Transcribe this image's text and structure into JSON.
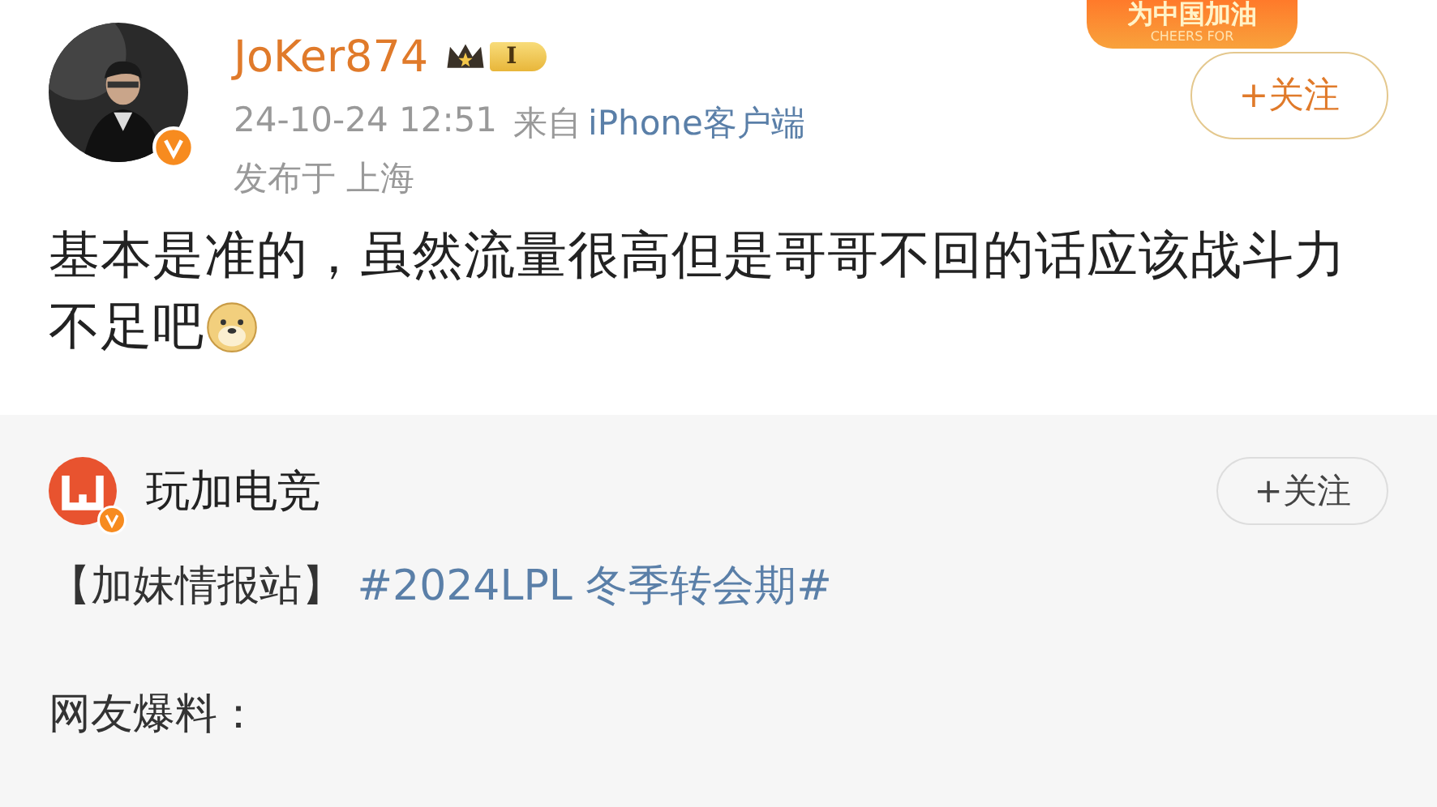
{
  "post": {
    "author": "JoKer874",
    "level": "I",
    "time": "24-10-24 12:51",
    "source_prefix": "来自",
    "source": "iPhone客户端",
    "location": "发布于 上海",
    "follow": "+关注",
    "badge": {
      "title": "为中国加油",
      "subtitle": "CHEERS FOR"
    },
    "text": "基本是准的，虽然流量很高但是哥哥不回的话应该战斗力不足吧"
  },
  "repost": {
    "author": "玩加电竞",
    "follow": "+关注",
    "tag": "【加妹情报站】",
    "hashtag": "#2024LPL 冬季转会期#",
    "text": "网友爆料："
  }
}
